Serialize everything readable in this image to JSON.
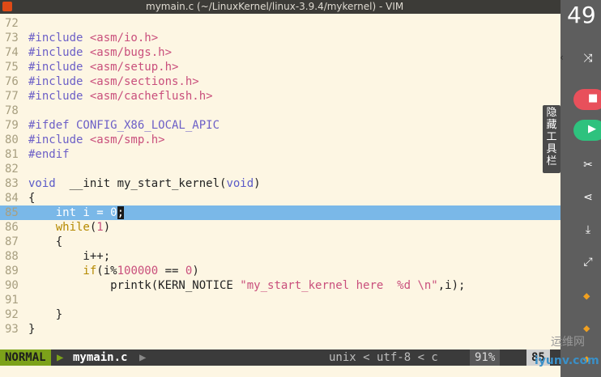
{
  "window": {
    "title": "mymain.c (~/LinuxKernel/linux-3.9.4/mykernel) - VIM"
  },
  "editor": {
    "lines": [
      {
        "num": "72",
        "segs": []
      },
      {
        "num": "73",
        "segs": [
          [
            "kw-inc",
            "#include "
          ],
          [
            "str",
            "<asm/io.h>"
          ]
        ]
      },
      {
        "num": "74",
        "segs": [
          [
            "kw-inc",
            "#include "
          ],
          [
            "str",
            "<asm/bugs.h>"
          ]
        ]
      },
      {
        "num": "75",
        "segs": [
          [
            "kw-inc",
            "#include "
          ],
          [
            "str",
            "<asm/setup.h>"
          ]
        ]
      },
      {
        "num": "76",
        "segs": [
          [
            "kw-inc",
            "#include "
          ],
          [
            "str",
            "<asm/sections.h>"
          ]
        ]
      },
      {
        "num": "77",
        "segs": [
          [
            "kw-inc",
            "#include "
          ],
          [
            "str",
            "<asm/cacheflush.h>"
          ]
        ]
      },
      {
        "num": "78",
        "segs": []
      },
      {
        "num": "79",
        "segs": [
          [
            "kw-inc",
            "#ifdef CONFIG_X86_LOCAL_APIC"
          ]
        ]
      },
      {
        "num": "80",
        "segs": [
          [
            "kw-inc",
            "#include "
          ],
          [
            "str",
            "<asm/smp.h>"
          ]
        ]
      },
      {
        "num": "81",
        "segs": [
          [
            "kw-inc",
            "#endif"
          ]
        ]
      },
      {
        "num": "82",
        "segs": []
      },
      {
        "num": "83",
        "segs": [
          [
            "kw-type",
            "void"
          ],
          [
            "",
            "  __init my_start_kernel("
          ],
          [
            "kw-type",
            "void"
          ],
          [
            "",
            ")"
          ]
        ]
      },
      {
        "num": "84",
        "segs": [
          [
            "",
            "{"
          ]
        ]
      },
      {
        "num": "85",
        "segs": [
          [
            "",
            "    int i = 0"
          ],
          [
            "cur",
            ";"
          ]
        ],
        "current": true
      },
      {
        "num": "86",
        "segs": [
          [
            "kw-stmt",
            "    while"
          ],
          [
            "",
            "("
          ],
          [
            "num",
            "1"
          ],
          [
            "",
            ")"
          ]
        ]
      },
      {
        "num": "87",
        "segs": [
          [
            "",
            "    {"
          ]
        ]
      },
      {
        "num": "88",
        "segs": [
          [
            "",
            "        i++;"
          ]
        ]
      },
      {
        "num": "89",
        "segs": [
          [
            "kw-stmt",
            "        if"
          ],
          [
            "",
            "(i%"
          ],
          [
            "num",
            "100000"
          ],
          [
            "",
            " == "
          ],
          [
            "num",
            "0"
          ],
          [
            "",
            ")"
          ]
        ]
      },
      {
        "num": "90",
        "segs": [
          [
            "",
            "            printk(KERN_NOTICE "
          ],
          [
            "str",
            "\"my_start_kernel here  %d \\n\""
          ],
          [
            "",
            ",i);"
          ]
        ]
      },
      {
        "num": "91",
        "segs": []
      },
      {
        "num": "92",
        "segs": [
          [
            "",
            "    }"
          ]
        ]
      },
      {
        "num": "93",
        "segs": [
          [
            "",
            "}"
          ]
        ]
      }
    ]
  },
  "statusline": {
    "mode": "NORMAL",
    "filename": "mymain.c",
    "right": "unix < utf-8 < c",
    "percent": "91%",
    "position": "85"
  },
  "panel": {
    "clock": "49",
    "hide_toolbar_label": "隐藏工具栏"
  },
  "watermark": {
    "top": "运维网",
    "url": "iyunv.com"
  },
  "colors": {
    "background": "#fdf6e3",
    "cursor_line": "#7ab8e8",
    "mode_bg": "#7ca21a",
    "preprocessor": "#6c5fc7",
    "string": "#c94f7c"
  }
}
